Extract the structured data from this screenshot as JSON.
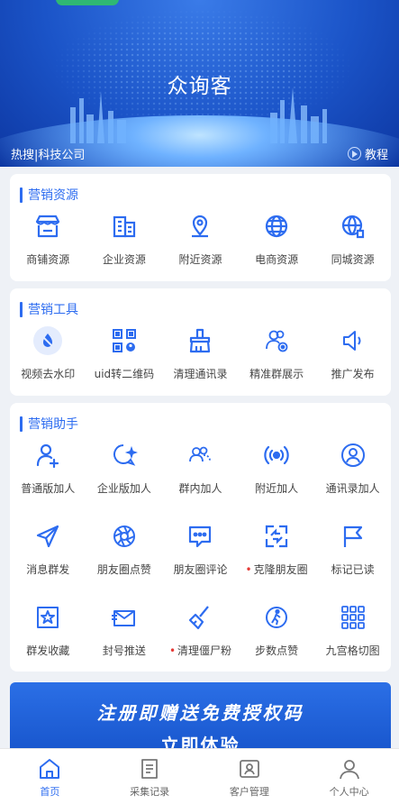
{
  "hero": {
    "title": "众询客",
    "subtitle_left": "热搜|科技公司",
    "tutorial_label": "教程"
  },
  "sections": [
    {
      "title": "营销资源",
      "items": [
        {
          "label": "商铺资源",
          "icon": "shop-icon"
        },
        {
          "label": "企业资源",
          "icon": "building-icon"
        },
        {
          "label": "附近资源",
          "icon": "location-pin-icon"
        },
        {
          "label": "电商资源",
          "icon": "globe-icon"
        },
        {
          "label": "同城资源",
          "icon": "city-globe-icon"
        }
      ]
    },
    {
      "title": "营销工具",
      "items": [
        {
          "label": "视频去水印",
          "icon": "water-drop-icon"
        },
        {
          "label": "uid转二维码",
          "icon": "qr-code-icon"
        },
        {
          "label": "清理通讯录",
          "icon": "broom-icon"
        },
        {
          "label": "精准群展示",
          "icon": "group-target-icon"
        },
        {
          "label": "推广发布",
          "icon": "speaker-icon"
        }
      ]
    },
    {
      "title": "营销助手",
      "rows": [
        [
          {
            "label": "普通版加人",
            "icon": "add-user-icon"
          },
          {
            "label": "企业版加人",
            "icon": "chat-sparkle-icon"
          },
          {
            "label": "群内加人",
            "icon": "group-icon"
          },
          {
            "label": "附近加人",
            "icon": "radar-icon"
          },
          {
            "label": "通讯录加人",
            "icon": "contact-icon"
          }
        ],
        [
          {
            "label": "消息群发",
            "icon": "send-icon"
          },
          {
            "label": "朋友圈点赞",
            "icon": "aperture-icon"
          },
          {
            "label": "朋友圈评论",
            "icon": "comment-icon"
          },
          {
            "label": "克隆朋友圈",
            "icon": "clone-icon",
            "dot": true
          },
          {
            "label": "标记已读",
            "icon": "flag-icon"
          }
        ],
        [
          {
            "label": "群发收藏",
            "icon": "star-box-icon"
          },
          {
            "label": "封号推送",
            "icon": "mail-icon"
          },
          {
            "label": "清理僵尸粉",
            "icon": "brush-icon",
            "dot": true
          },
          {
            "label": "步数点赞",
            "icon": "walk-icon"
          },
          {
            "label": "九宫格切图",
            "icon": "grid-nine-icon"
          }
        ]
      ]
    }
  ],
  "banner": {
    "line1": "注册即赠送免费授权码",
    "line2": "立即体验"
  },
  "tabbar": [
    {
      "label": "首页",
      "icon": "home-icon",
      "active": true
    },
    {
      "label": "采集记录",
      "icon": "record-icon"
    },
    {
      "label": "客户管理",
      "icon": "customer-card-icon"
    },
    {
      "label": "个人中心",
      "icon": "person-icon"
    }
  ],
  "accent_color": "#2d6cf0"
}
